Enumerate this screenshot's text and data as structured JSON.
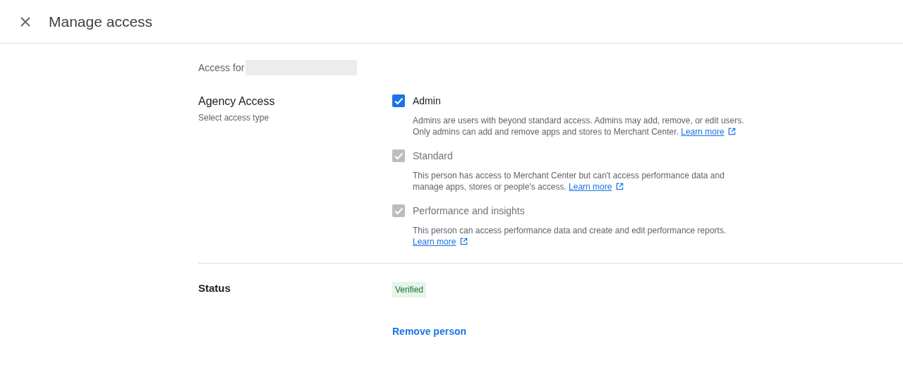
{
  "header": {
    "title": "Manage access"
  },
  "access_for": {
    "label": "Access for",
    "redacted": true
  },
  "agency_access": {
    "title": "Agency Access",
    "subtitle": "Select access type",
    "options": [
      {
        "label": "Admin",
        "checked": true,
        "disabled": false,
        "description": "Admins are users with beyond standard access. Admins may add, remove, or edit users. Only admins can add and remove apps and stores to Merchant Center.",
        "link": "Learn more"
      },
      {
        "label": "Standard",
        "checked": true,
        "disabled": true,
        "description": "This person has access to Merchant Center but can't access performance data and manage apps, stores or people's access.",
        "link": "Learn more"
      },
      {
        "label": "Performance and insights",
        "checked": true,
        "disabled": true,
        "description": "This person can access performance data and create and edit performance reports.",
        "link": "Learn more"
      }
    ]
  },
  "status": {
    "label": "Status",
    "badge": "Verified"
  },
  "remove_button": "Remove person"
}
